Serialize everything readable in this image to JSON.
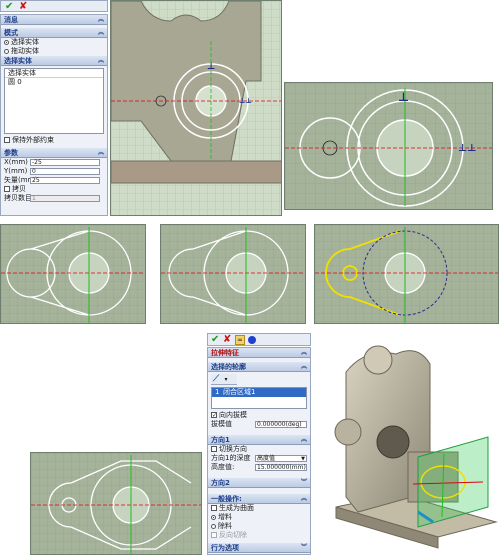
{
  "left_panel": {
    "message_header": "消息",
    "mode_header": "模式",
    "mode_options": [
      "选择实体",
      "拖动实体"
    ],
    "select_entity_header": "选择实体",
    "entity_list_header": "选择实体",
    "entity_list_items": [
      "圆 0"
    ],
    "keep_constraint_label": "保持外部约束",
    "params_header": "参数",
    "params": [
      {
        "label": "X(mm)",
        "value": "-25"
      },
      {
        "label": "Y(mm)",
        "value": "0"
      },
      {
        "label": "矢量(mm)",
        "value": "25"
      }
    ],
    "copy_label": "拷贝",
    "copy_count_label": "拷贝数目",
    "copy_count_value": "1"
  },
  "stretch_panel": {
    "title": "拉伸特征",
    "profile_header": "选择的轮廓",
    "profile_item_index": "1",
    "profile_item_label": "闭合区域1",
    "draft_in_label": "向内拔模",
    "draft_value_label": "拔模值",
    "draft_value": "0.000000(deg)",
    "direction1_header": "方向1",
    "switch_direction_label": "切换方向",
    "depth_type_label": "方向1的深度",
    "depth_type_value": "高度值",
    "height_label": "高度值:",
    "height_value": "15.000000(mm)",
    "direction2_header": "方向2",
    "general_ops_header": "一般操作:",
    "ops": [
      "生成为曲面",
      "增料",
      "除料",
      "反向切除"
    ],
    "behavior_header": "行为选项"
  },
  "colors": {
    "sketch_bg": "#cfdcc7",
    "part_body": "#a7a794",
    "sketch_line": "#ffffff",
    "axis_red": "#e0000f",
    "axis_green": "#1fbf1f",
    "highlight_yellow": "#f0e000"
  },
  "icons": [
    "ok-check-icon",
    "cancel-x-icon",
    "tool-icon",
    "sphere-icon",
    "line-tool-icon"
  ]
}
